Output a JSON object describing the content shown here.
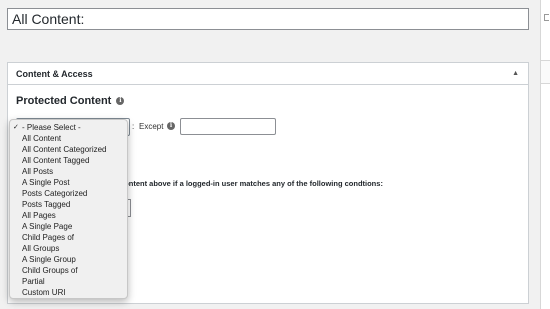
{
  "title_field": {
    "value": "All Content:"
  },
  "postbox": {
    "title": "Content & Access",
    "toggle_icon": "triangle-up-icon"
  },
  "protected_content": {
    "heading": "Protected Content",
    "select_value": "- Please Select -",
    "colon": ":",
    "except_label": "Except",
    "except_value": "",
    "condition_text": "content above if a logged-in user matches any of the following condtions:"
  },
  "dropdown": {
    "check_glyph": "✓",
    "options": [
      "- Please Select -",
      "All Content",
      "All Content Categorized",
      "All Content Tagged",
      "All Posts",
      "A Single Post",
      "Posts Categorized",
      "Posts Tagged",
      "All Pages",
      "A Single Page",
      "Child Pages of",
      "All Groups",
      "A Single Group",
      "Child Groups of",
      "Partial",
      "Custom URI"
    ]
  }
}
